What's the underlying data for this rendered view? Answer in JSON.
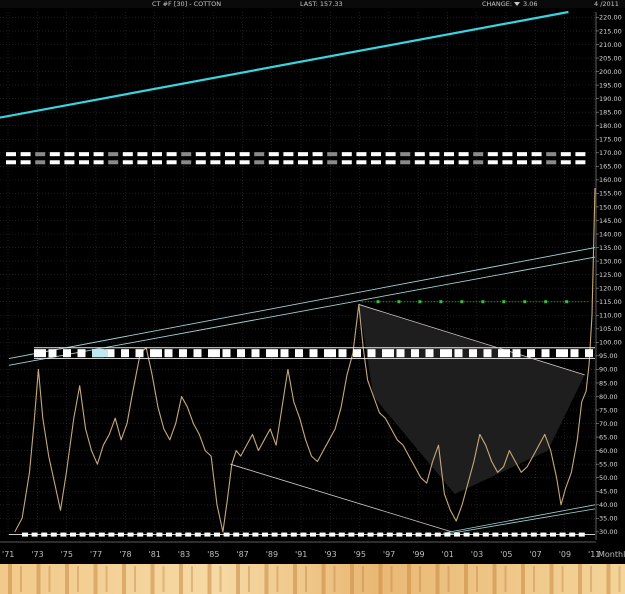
{
  "header": {
    "symbol": "CT #F [30] - COTTON",
    "last_label": "LAST: 157.33",
    "change_label": "CHANGE:",
    "change_value": "3.06",
    "date_right": "4  /2011"
  },
  "x_axis": {
    "labels": [
      "'71",
      "'73",
      "'75",
      "'77",
      "'78",
      "'81",
      "'83",
      "'85",
      "'87",
      "'89",
      "'91",
      "'93",
      "'95",
      "'97",
      "'99",
      "'01",
      "'03",
      "'05",
      "'07",
      "'09",
      "'11",
      "Monthly"
    ]
  },
  "chart_data": {
    "type": "line",
    "title": "CT #F [30] - COTTON",
    "xlabel": "",
    "ylabel": "",
    "interval": "Monthly",
    "xlim": [
      1971,
      2011.3
    ],
    "ylim": [
      27,
      222
    ],
    "y_ticks": [
      30,
      35,
      40,
      45,
      50,
      55,
      60,
      65,
      70,
      75,
      80,
      85,
      90,
      95,
      100,
      105,
      110,
      115,
      120,
      125,
      130,
      135,
      140,
      145,
      150,
      155,
      160,
      165,
      170,
      175,
      180,
      185,
      190,
      195,
      200,
      205,
      210,
      215,
      220
    ],
    "last": 157.33,
    "change": 3.06,
    "series": [
      {
        "x": [
          1972.0,
          1972.5,
          1973.0,
          1973.3,
          1973.6,
          1973.9,
          1974.3,
          1974.7,
          1975.1,
          1975.5,
          1976.0,
          1976.4,
          1976.8,
          1977.2,
          1977.6,
          1978.0,
          1978.4,
          1978.8,
          1979.2,
          1979.6,
          1980.0,
          1980.5,
          1980.9,
          1981.3,
          1981.7,
          1982.1,
          1982.5,
          1982.9,
          1983.3,
          1983.7,
          1984.1,
          1984.5,
          1984.9,
          1985.3,
          1985.7,
          1986.1,
          1986.4,
          1986.7,
          1987.0,
          1987.3,
          1987.7,
          1988.1,
          1988.5,
          1988.9,
          1989.3,
          1989.7,
          1990.1,
          1990.5,
          1990.9,
          1991.3,
          1991.7,
          1992.1,
          1992.5,
          1992.9,
          1993.3,
          1993.7,
          1994.1,
          1994.5,
          1994.9,
          1995.3,
          1995.6,
          1995.9,
          1996.3,
          1996.7,
          1997.1,
          1997.5,
          1997.9,
          1998.3,
          1998.7,
          1999.1,
          1999.5,
          1999.9,
          2000.3,
          2000.7,
          2001.1,
          2001.5,
          2001.9,
          2002.3,
          2002.7,
          2003.1,
          2003.5,
          2003.9,
          2004.3,
          2004.7,
          2005.1,
          2005.5,
          2005.9,
          2006.3,
          2006.7,
          2007.1,
          2007.5,
          2007.9,
          2008.3,
          2008.7,
          2009.0,
          2009.3,
          2009.7,
          2010.1,
          2010.4,
          2010.7,
          2010.9,
          2011.1,
          2011.3
        ],
        "y": [
          30,
          35,
          52,
          70,
          90,
          72,
          58,
          48,
          38,
          52,
          72,
          84,
          68,
          60,
          55,
          62,
          66,
          72,
          64,
          70,
          82,
          96,
          98,
          88,
          76,
          68,
          64,
          70,
          80,
          76,
          70,
          66,
          60,
          58,
          40,
          30,
          42,
          55,
          60,
          58,
          62,
          66,
          60,
          64,
          68,
          62,
          76,
          90,
          78,
          72,
          64,
          58,
          56,
          60,
          64,
          68,
          76,
          88,
          96,
          114,
          98,
          86,
          80,
          74,
          72,
          68,
          64,
          62,
          58,
          54,
          50,
          48,
          56,
          62,
          44,
          38,
          34,
          40,
          48,
          56,
          66,
          62,
          56,
          52,
          54,
          60,
          56,
          52,
          54,
          58,
          62,
          66,
          60,
          50,
          40,
          46,
          52,
          64,
          78,
          82,
          92,
          110,
          157
        ]
      }
    ]
  },
  "overlays": {
    "upper_channel_line_color": "#37d5e0",
    "trend_line_color": "#9fd4d6",
    "support_lines_color": "#e8e8e8",
    "triangle_line_color": "#d8c8c8",
    "dotted_resistance_color": "#3fbf3f",
    "price_line_color": "#c8a878",
    "background_color": "#000000",
    "grid_color": "#2e2e2e"
  }
}
